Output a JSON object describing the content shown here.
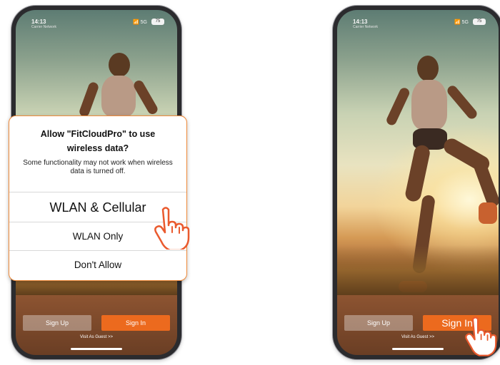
{
  "left_phone": {
    "status": {
      "time": "14:13",
      "sub": "Carrier Network",
      "signal": "📶 5G",
      "battery": "75"
    },
    "dialog": {
      "title_line1": "Allow \"FitCloudPro\" to use",
      "title_line2": "wireless data?",
      "message": "Some functionality may not work when wireless data is turned off.",
      "options": [
        "WLAN & Cellular",
        "WLAN Only",
        "Don't Allow"
      ]
    },
    "buttons": {
      "sign_up": "Sign Up",
      "sign_in": "Sign In"
    },
    "guest_link": "Visit As Guest >>"
  },
  "right_phone": {
    "status": {
      "time": "14:13",
      "sub": "Carrier Network",
      "signal": "📶 5G",
      "battery": "75"
    },
    "buttons": {
      "sign_up": "Sign Up",
      "sign_in": "Sign In"
    },
    "guest_link": "Visit As Guest >>"
  },
  "accent_color": "#ec6a1e",
  "pointer_icon": "hand-pointer-icon"
}
